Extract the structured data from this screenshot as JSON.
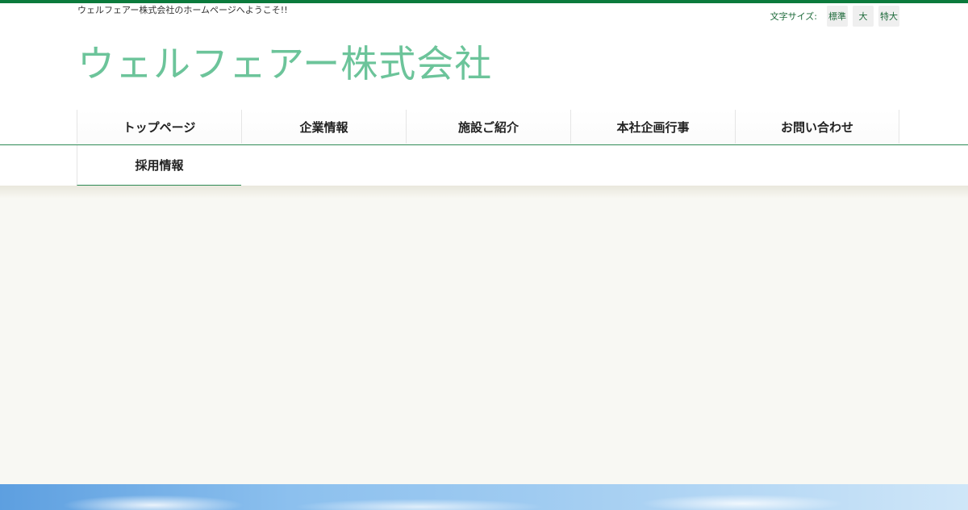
{
  "header": {
    "tagline": "ウェルフェアー株式会社のホームページへようこそ!!",
    "site_title": "ウェルフェアー株式会社"
  },
  "font_size_control": {
    "label": "文字サイズ:",
    "options": [
      "標準",
      "大",
      "特大"
    ]
  },
  "nav": {
    "items": [
      "トップページ",
      "企業情報",
      "施設ご紹介",
      "本社企画行事",
      "お問い合わせ",
      "採用情報"
    ]
  },
  "colors": {
    "brand_green": "#0b7a3c",
    "title_green": "#6cc49a",
    "content_bg": "#f8f8f3"
  }
}
